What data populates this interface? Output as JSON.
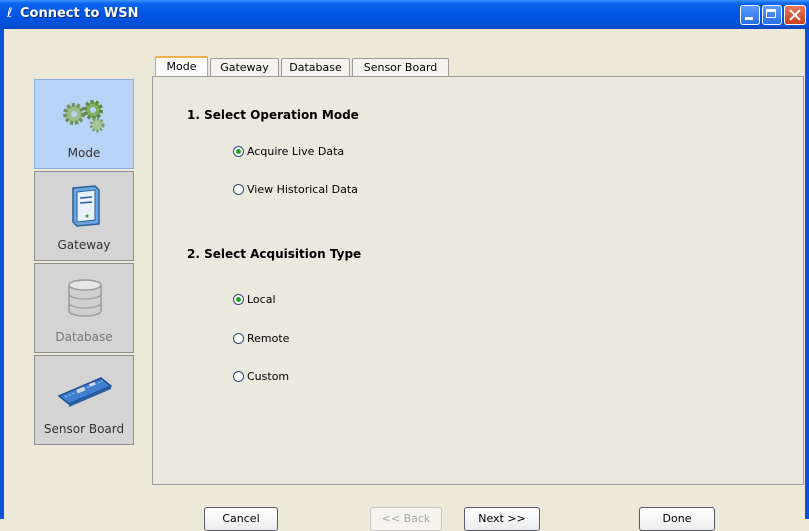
{
  "window": {
    "title": "Connect to WSN"
  },
  "sidebar": {
    "items": [
      {
        "label": "Mode",
        "icon": "gears-icon",
        "active": true
      },
      {
        "label": "Gateway",
        "icon": "computer-tower-icon"
      },
      {
        "label": "Database",
        "icon": "database-icon",
        "disabled": true
      },
      {
        "label": "Sensor Board",
        "icon": "circuit-board-icon"
      }
    ]
  },
  "tabs": [
    {
      "label": "Mode",
      "active": true
    },
    {
      "label": "Gateway"
    },
    {
      "label": "Database"
    },
    {
      "label": "Sensor Board"
    }
  ],
  "mode_panel": {
    "section1": {
      "heading": "1. Select Operation Mode",
      "options": [
        {
          "label": "Acquire Live Data",
          "checked": true
        },
        {
          "label": "View Historical Data",
          "checked": false
        }
      ]
    },
    "section2": {
      "heading": "2. Select Acquisition Type",
      "options": [
        {
          "label": "Local",
          "checked": true
        },
        {
          "label": "Remote",
          "checked": false
        },
        {
          "label": "Custom",
          "checked": false
        }
      ]
    }
  },
  "buttons": {
    "cancel": "Cancel",
    "back": "<< Back",
    "next": "Next >>",
    "done": "Done"
  },
  "colors": {
    "titlebar": "#0054e3",
    "active_nav": "#b9d3f7",
    "radio_dot": "#21a121",
    "tab_highlight": "#f3b04a"
  }
}
